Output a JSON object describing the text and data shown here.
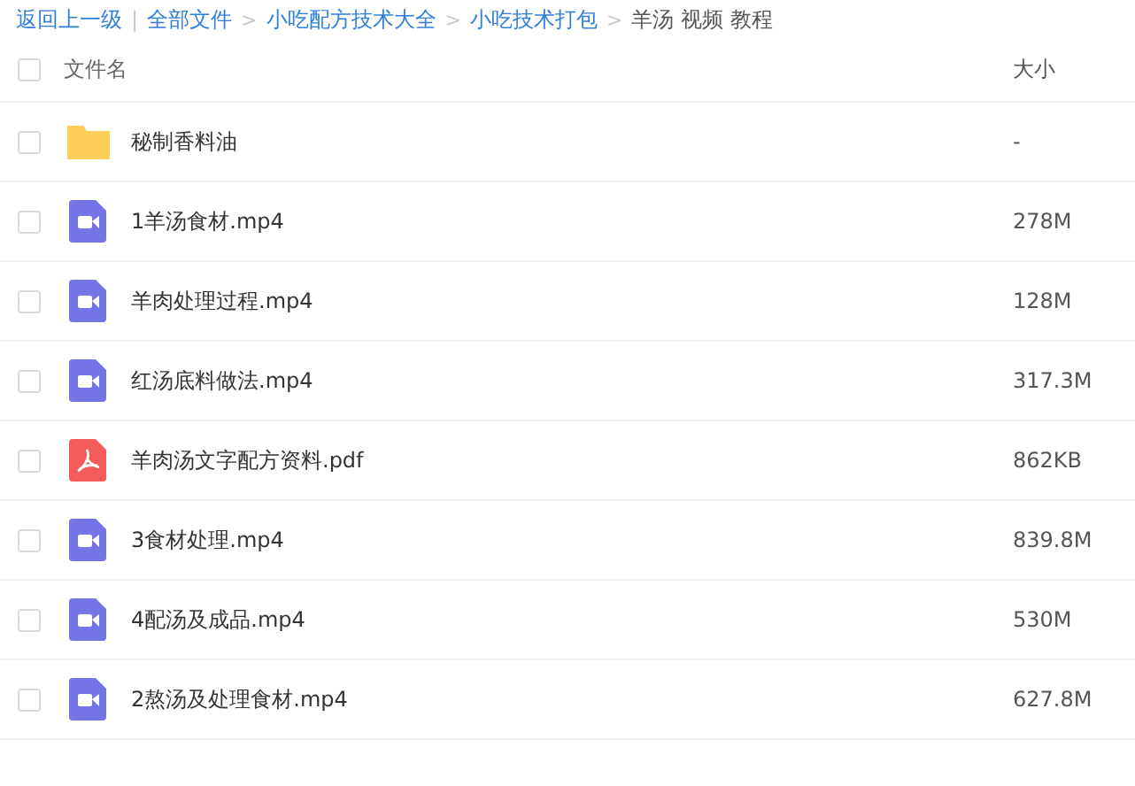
{
  "breadcrumb": [
    {
      "kind": "link",
      "label": "返回上一级"
    },
    {
      "kind": "divider",
      "label": "|"
    },
    {
      "kind": "link",
      "label": "全部文件"
    },
    {
      "kind": "separator",
      "label": ">"
    },
    {
      "kind": "link",
      "label": "小吃配方技术大全"
    },
    {
      "kind": "separator",
      "label": ">"
    },
    {
      "kind": "link",
      "label": "小吃技术打包"
    },
    {
      "kind": "separator",
      "label": ">"
    },
    {
      "kind": "current",
      "label": "羊汤 视频 教程"
    }
  ],
  "table": {
    "select_all_checked": false,
    "columns": [
      "文件名",
      "大小"
    ],
    "rows": [
      {
        "kind": "folder",
        "name": "秘制香料油",
        "size": "-",
        "checked": false
      },
      {
        "kind": "video",
        "name": "1羊汤食材.mp4",
        "size": "278M",
        "checked": false
      },
      {
        "kind": "video",
        "name": "羊肉处理过程.mp4",
        "size": "128M",
        "checked": false
      },
      {
        "kind": "video",
        "name": "红汤底料做法.mp4",
        "size": "317.3M",
        "checked": false
      },
      {
        "kind": "pdf",
        "name": "羊肉汤文字配方资料.pdf",
        "size": "862KB",
        "checked": false
      },
      {
        "kind": "video",
        "name": "3食材处理.mp4",
        "size": "839.8M",
        "checked": false
      },
      {
        "kind": "video",
        "name": "4配汤及成品.mp4",
        "size": "530M",
        "checked": false
      },
      {
        "kind": "video",
        "name": "2熬汤及处理食材.mp4",
        "size": "627.8M",
        "checked": false
      }
    ]
  }
}
